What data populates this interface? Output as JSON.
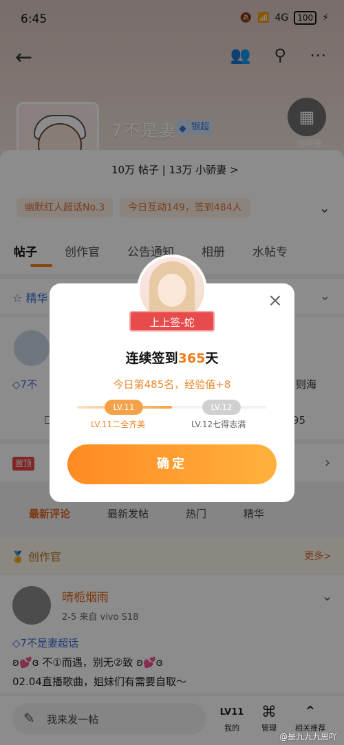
{
  "status_bar": {
    "time": "6:45",
    "network": "4G",
    "battery": "100"
  },
  "topic": {
    "name": "7不是妻",
    "badge": "银超",
    "stats": "10万 帖子 | 13万 小骄妻 >",
    "checkin_label": "连续签…"
  },
  "chips": [
    "幽默红人超话No.3",
    "今日互动149，签到484人"
  ],
  "tabs": [
    "帖子",
    "创作官",
    "公告通知",
    "相册",
    "水帖专"
  ],
  "sections": {
    "featured": "精华",
    "post1_link": "7不",
    "post1_right": "则海",
    "post1_count": "95",
    "pin_tag": "置顶",
    "sort_buttons": [
      "最新评论",
      "最新发帖",
      "热门",
      "精华"
    ],
    "creator_title": "创作官",
    "creator_more": "更多>"
  },
  "post": {
    "author": "晴栀烟雨",
    "meta": "2-5  来自 vivo S18",
    "topic_link": "7不是妻超话",
    "line1": "ʚ💕ɞ 不①而遇，别无②致 ʚ💕ɞ",
    "line2": "02.04直播歌曲，姐妹们有需要自取～"
  },
  "bottom_bar": {
    "composer_placeholder": "我来发一帖",
    "items": [
      {
        "icon": "level-icon",
        "label": "我的",
        "glyph": "LV11"
      },
      {
        "icon": "manage-icon",
        "label": "管理",
        "glyph": "⌘"
      },
      {
        "icon": "recommend-icon",
        "label": "相关推荐",
        "glyph": "⌃"
      }
    ]
  },
  "watermark": "@是九九九思吖",
  "modal": {
    "ribbon": "上上签-蛇",
    "title_prefix": "连续签到",
    "title_days": "365",
    "title_suffix": "天",
    "subtitle": "今日第485名，经验值+8",
    "level_current": "LV.11",
    "level_next": "LV.12",
    "level_current_name": "LV.11二全齐美",
    "level_next_name": "LV.12七得志满",
    "progress": 0.5,
    "confirm": "确定"
  },
  "colors": {
    "accent": "#f58220",
    "link": "#3a6fd6",
    "overlay": "rgba(0,0,0,0.45)"
  }
}
